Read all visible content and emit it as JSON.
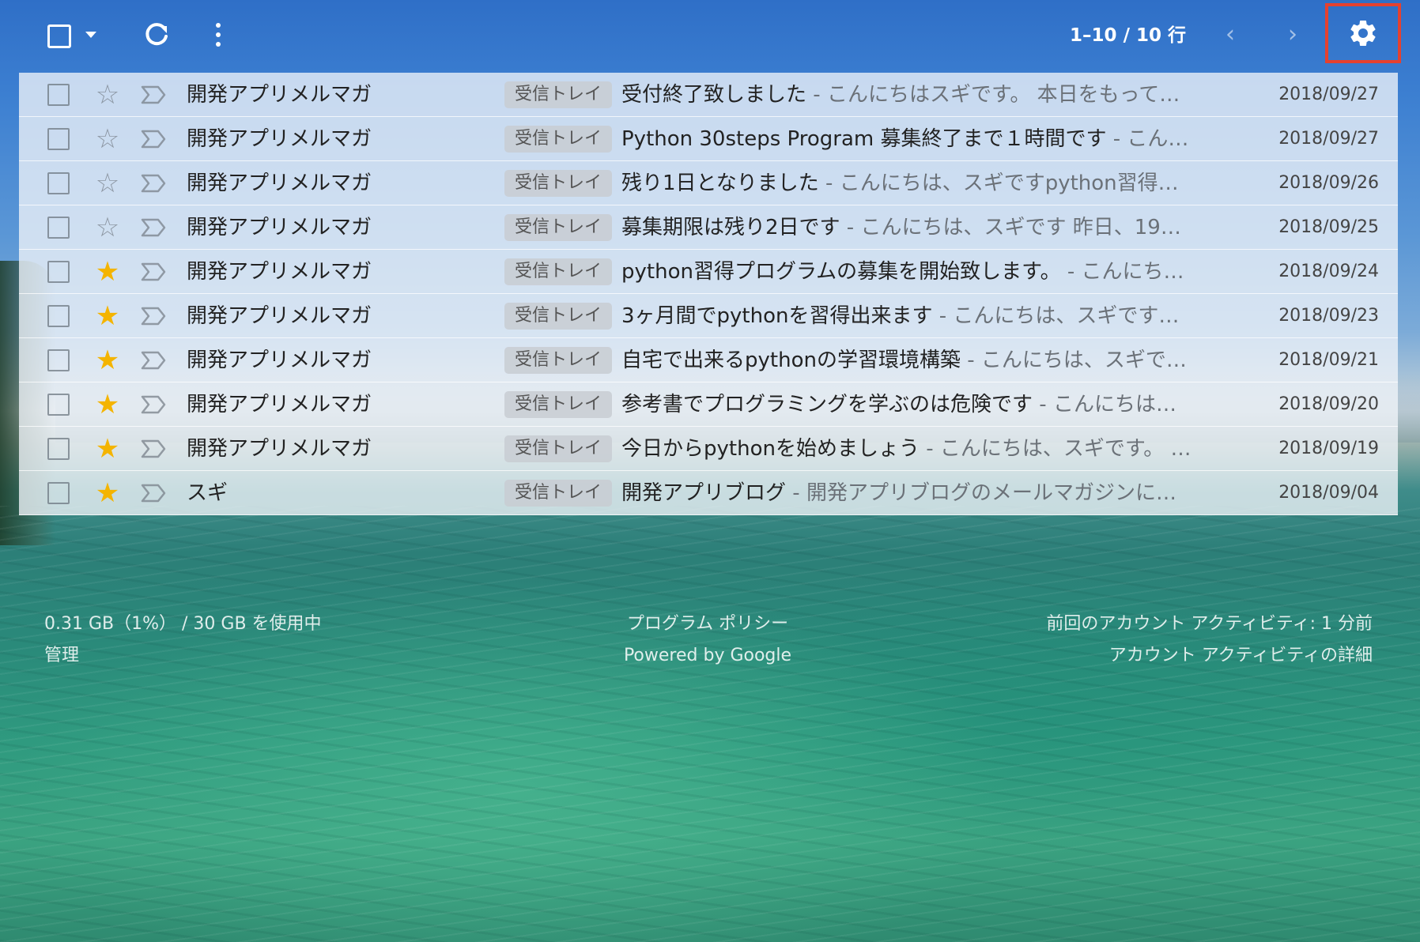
{
  "toolbar": {
    "select_icon": "checkbox-icon",
    "refresh_icon": "refresh-icon",
    "more_icon": "more-vert-icon",
    "pager_text": "1–10 / 10 行",
    "prev_icon": "chevron-left-icon",
    "next_icon": "chevron-right-icon",
    "settings_icon": "gear-icon",
    "settings_highlight_color": "#e5412f"
  },
  "emails": [
    {
      "sender": "開発アプリメルマガ",
      "label": "受信トレイ",
      "subject": "受付終了致しました",
      "snippet": "こんにちはスギです。 本日をもって…",
      "date": "2018/09/27",
      "starred": false
    },
    {
      "sender": "開発アプリメルマガ",
      "label": "受信トレイ",
      "subject": "Python 30steps Program 募集終了まで１時間です",
      "snippet": "こん…",
      "date": "2018/09/27",
      "starred": false
    },
    {
      "sender": "開発アプリメルマガ",
      "label": "受信トレイ",
      "subject": "残り1日となりました",
      "snippet": "こんにちは、スギですpython習得…",
      "date": "2018/09/26",
      "starred": false
    },
    {
      "sender": "開発アプリメルマガ",
      "label": "受信トレイ",
      "subject": "募集期限は残り2日です",
      "snippet": "こんにちは、スギです 昨日、19…",
      "date": "2018/09/25",
      "starred": false
    },
    {
      "sender": "開発アプリメルマガ",
      "label": "受信トレイ",
      "subject": "python習得プログラムの募集を開始致します。",
      "snippet": "こんにち…",
      "date": "2018/09/24",
      "starred": true
    },
    {
      "sender": "開発アプリメルマガ",
      "label": "受信トレイ",
      "subject": "3ヶ月間でpythonを習得出来ます",
      "snippet": "こんにちは、スギです…",
      "date": "2018/09/23",
      "starred": true
    },
    {
      "sender": "開発アプリメルマガ",
      "label": "受信トレイ",
      "subject": "自宅で出来るpythonの学習環境構築",
      "snippet": "こんにちは、スギで…",
      "date": "2018/09/21",
      "starred": true
    },
    {
      "sender": "開発アプリメルマガ",
      "label": "受信トレイ",
      "subject": "参考書でプログラミングを学ぶのは危険です",
      "snippet": "こんにちは…",
      "date": "2018/09/20",
      "starred": true
    },
    {
      "sender": "開発アプリメルマガ",
      "label": "受信トレイ",
      "subject": "今日からpythonを始めましょう",
      "snippet": "こんにちは、スギです。 …",
      "date": "2018/09/19",
      "starred": true
    },
    {
      "sender": "スギ",
      "label": "受信トレイ",
      "subject": "開発アプリブログ",
      "snippet": "開発アプリブログのメールマガジンに…",
      "date": "2018/09/04",
      "starred": true
    }
  ],
  "separator": " - ",
  "star_color": "#f4b400",
  "footer": {
    "storage": "0.31 GB（1%） / 30 GB を使用中",
    "manage": "管理",
    "policy": "プログラム ポリシー",
    "powered": "Powered by Google",
    "last_activity": "前回のアカウント アクティビティ: 1 分前",
    "activity_details": "アカウント アクティビティの詳細"
  }
}
